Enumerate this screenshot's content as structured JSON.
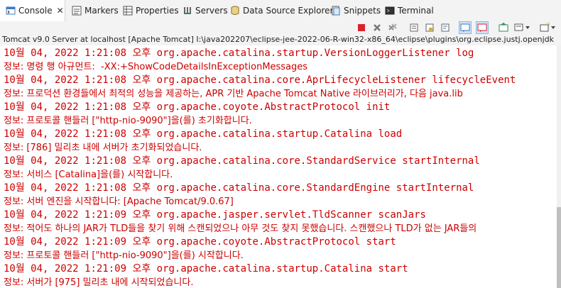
{
  "tabs": [
    {
      "label": "Console",
      "icon": "console-icon",
      "active": true
    },
    {
      "label": "Markers",
      "icon": "markers-icon"
    },
    {
      "label": "Properties",
      "icon": "properties-icon"
    },
    {
      "label": "Servers",
      "icon": "servers-icon"
    },
    {
      "label": "Data Source Explorer",
      "icon": "data-source-explorer-icon"
    },
    {
      "label": "Snippets",
      "icon": "snippets-icon"
    },
    {
      "label": "Terminal",
      "icon": "terminal-icon"
    }
  ],
  "close_glyph": "✕",
  "toolbar_icons": [
    "terminate-icon",
    "remove-launch-icon",
    "remove-all-terminated-icon",
    "clear-console-icon",
    "scroll-lock-icon",
    "word-wrap-icon",
    "show-on-stdout-icon",
    "show-on-stderr-icon",
    "pin-console-icon",
    "display-selected-console-icon",
    "open-console-icon",
    "view-menu-icon"
  ],
  "status": "Tomcat v9.0 Server at localhost [Apache Tomcat] I:\\java202207\\eclipse-jee-2022-06-R-win32-x86_64\\eclipse\\plugins\\org.eclipse.justj.openjdk",
  "colors": {
    "log_text": "#cc0000",
    "terminate": "#d9232d",
    "accent": "#3c7ac4"
  },
  "console_lines": [
    "10월 04, 2022 1:21:08 오후 org.apache.catalina.startup.VersionLoggerListener log",
    "정보: 명령 행 아규먼트:  -XX:+ShowCodeDetailsInExceptionMessages",
    "10월 04, 2022 1:21:08 오후 org.apache.catalina.core.AprLifecycleListener lifecycleEvent",
    "정보: 프로덕션 환경들에서 최적의 성능을 제공하는, APR 기반 Apache Tomcat Native 라이브러리가, 다음 java.lib",
    "10월 04, 2022 1:21:08 오후 org.apache.coyote.AbstractProtocol init",
    "정보: 프로토콜 핸들러 [\"http-nio-9090\"]을(를) 초기화합니다.",
    "10월 04, 2022 1:21:08 오후 org.apache.catalina.startup.Catalina load",
    "정보: [786] 밀리초 내에 서버가 초기화되었습니다.",
    "10월 04, 2022 1:21:08 오후 org.apache.catalina.core.StandardService startInternal",
    "정보: 서비스 [Catalina]을(를) 시작합니다.",
    "10월 04, 2022 1:21:08 오후 org.apache.catalina.core.StandardEngine startInternal",
    "정보: 서버 엔진을 시작합니다: [Apache Tomcat/9.0.67]",
    "10월 04, 2022 1:21:09 오후 org.apache.jasper.servlet.TldScanner scanJars",
    "정보: 적어도 하나의 JAR가 TLD들을 찾기 위해 스캔되었으나 아무 것도 찾지 못했습니다. 스캔했으나 TLD가 없는 JAR들의",
    "10월 04, 2022 1:21:09 오후 org.apache.coyote.AbstractProtocol start",
    "정보: 프로토콜 핸들러 [\"http-nio-9090\"]을(를) 시작합니다.",
    "10월 04, 2022 1:21:09 오후 org.apache.catalina.startup.Catalina start",
    "정보: 서버가 [975] 밀리초 내에 시작되었습니다."
  ]
}
